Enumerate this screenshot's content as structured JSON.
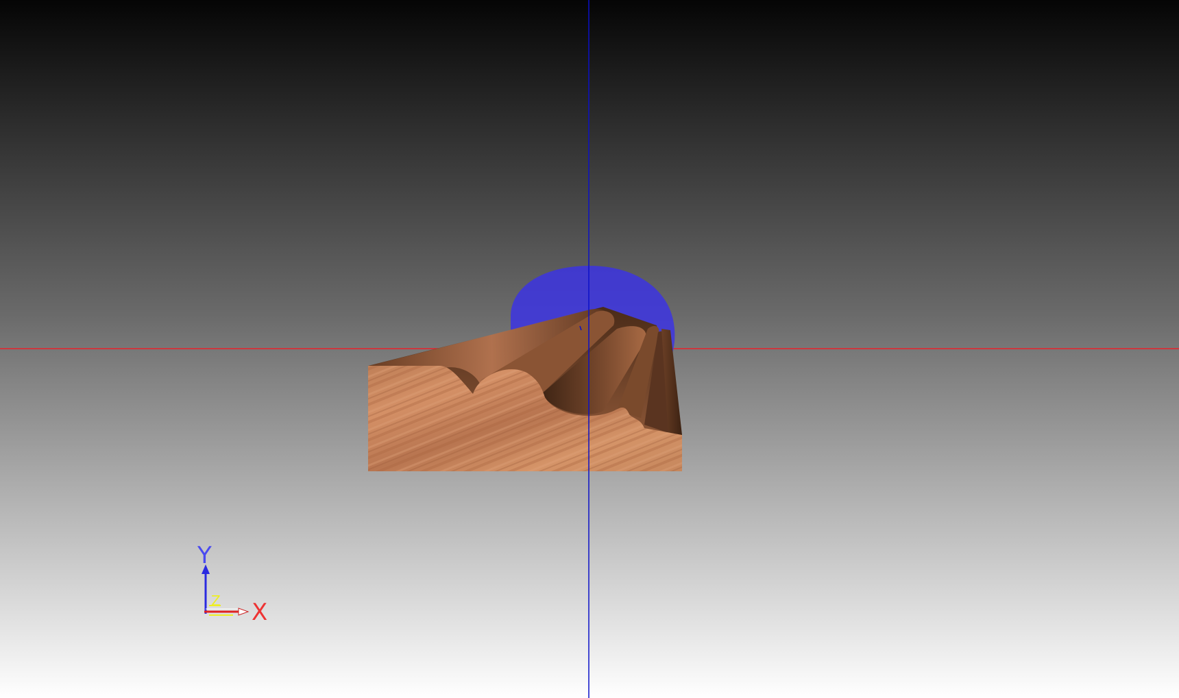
{
  "viewport": {
    "name": "3d-viewport",
    "background_top": "#050505",
    "background_bottom": "#ffffff"
  },
  "scene": {
    "x_axis_color": "#e8202a",
    "y_axis_color": "#0a10c8",
    "tool_color": "#3a32e6",
    "wood_light": "#c88456",
    "wood_dark": "#5a3520"
  },
  "triad": {
    "x_label": "X",
    "y_label": "Y",
    "z_label": "Z",
    "x_color": "#ee3333",
    "y_color": "#4a4af0",
    "z_color": "#eeee22",
    "x_icon": "arrow-right-icon",
    "y_icon": "arrow-up-icon"
  }
}
